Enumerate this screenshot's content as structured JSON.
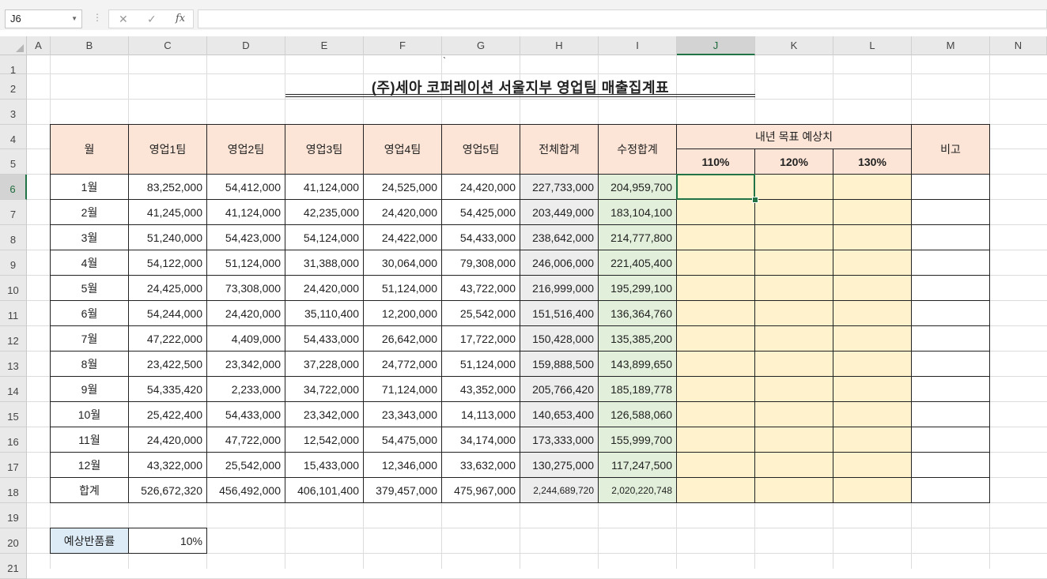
{
  "formula_bar": {
    "name_box": "J6",
    "cancel_icon": "✕",
    "enter_icon": "✓",
    "fx_label": "fx",
    "formula_value": ""
  },
  "columns": [
    "A",
    "B",
    "C",
    "D",
    "E",
    "F",
    "G",
    "H",
    "I",
    "J",
    "K",
    "L",
    "M",
    "N"
  ],
  "rows": [
    "1",
    "2",
    "3",
    "4",
    "5",
    "6",
    "7",
    "8",
    "9",
    "10",
    "11",
    "12",
    "13",
    "14",
    "15",
    "16",
    "17",
    "18",
    "19",
    "20",
    "21"
  ],
  "selected_cell": {
    "column": "J",
    "row": "6"
  },
  "sheet": {
    "tick_mark": "`",
    "title": "(주)세아 코퍼레이션 서울지부 영업팀 매출집계표",
    "headers": {
      "month": "월",
      "team1": "영업1팀",
      "team2": "영업2팀",
      "team3": "영업3팀",
      "team4": "영업4팀",
      "team5": "영업5팀",
      "total": "전체합계",
      "adjusted": "수정합계",
      "next_year": "내년 목표 예상치",
      "p110": "110%",
      "p120": "120%",
      "p130": "130%",
      "note": "비고"
    },
    "data_rows": [
      {
        "month": "1월",
        "v": [
          "83,252,000",
          "54,412,000",
          "41,124,000",
          "24,525,000",
          "24,420,000"
        ],
        "total": "227,733,000",
        "adjusted": "204,959,700"
      },
      {
        "month": "2월",
        "v": [
          "41,245,000",
          "41,124,000",
          "42,235,000",
          "24,420,000",
          "54,425,000"
        ],
        "total": "203,449,000",
        "adjusted": "183,104,100"
      },
      {
        "month": "3월",
        "v": [
          "51,240,000",
          "54,423,000",
          "54,124,000",
          "24,422,000",
          "54,433,000"
        ],
        "total": "238,642,000",
        "adjusted": "214,777,800"
      },
      {
        "month": "4월",
        "v": [
          "54,122,000",
          "51,124,000",
          "31,388,000",
          "30,064,000",
          "79,308,000"
        ],
        "total": "246,006,000",
        "adjusted": "221,405,400"
      },
      {
        "month": "5월",
        "v": [
          "24,425,000",
          "73,308,000",
          "24,420,000",
          "51,124,000",
          "43,722,000"
        ],
        "total": "216,999,000",
        "adjusted": "195,299,100"
      },
      {
        "month": "6월",
        "v": [
          "54,244,000",
          "24,420,000",
          "35,110,400",
          "12,200,000",
          "25,542,000"
        ],
        "total": "151,516,400",
        "adjusted": "136,364,760"
      },
      {
        "month": "7월",
        "v": [
          "47,222,000",
          "4,409,000",
          "54,433,000",
          "26,642,000",
          "17,722,000"
        ],
        "total": "150,428,000",
        "adjusted": "135,385,200"
      },
      {
        "month": "8월",
        "v": [
          "23,422,500",
          "23,342,000",
          "37,228,000",
          "24,772,000",
          "51,124,000"
        ],
        "total": "159,888,500",
        "adjusted": "143,899,650"
      },
      {
        "month": "9월",
        "v": [
          "54,335,420",
          "2,233,000",
          "34,722,000",
          "71,124,000",
          "43,352,000"
        ],
        "total": "205,766,420",
        "adjusted": "185,189,778"
      },
      {
        "month": "10월",
        "v": [
          "25,422,400",
          "54,433,000",
          "23,342,000",
          "23,343,000",
          "14,113,000"
        ],
        "total": "140,653,400",
        "adjusted": "126,588,060"
      },
      {
        "month": "11월",
        "v": [
          "24,420,000",
          "47,722,000",
          "12,542,000",
          "54,475,000",
          "34,174,000"
        ],
        "total": "173,333,000",
        "adjusted": "155,999,700"
      },
      {
        "month": "12월",
        "v": [
          "43,322,000",
          "25,542,000",
          "15,433,000",
          "12,346,000",
          "33,632,000"
        ],
        "total": "130,275,000",
        "adjusted": "117,247,500"
      }
    ],
    "sum_row": {
      "month": "합계",
      "v": [
        "526,672,320",
        "456,492,000",
        "406,101,400",
        "379,457,000",
        "475,967,000"
      ],
      "total": "2,244,689,720",
      "adjusted": "2,020,220,748"
    },
    "return_rate_label": "예상반품률",
    "return_rate_value": "10%"
  }
}
